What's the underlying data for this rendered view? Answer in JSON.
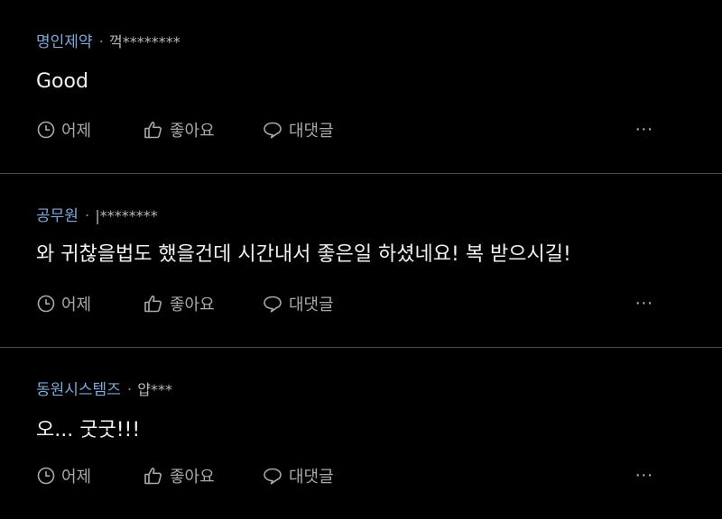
{
  "comments": [
    {
      "author": "명인제약",
      "separator": "·",
      "masked_user": "꺽********",
      "text": "Good",
      "time": "어제",
      "like_label": "좋아요",
      "reply_label": "대댓글",
      "more": "···"
    },
    {
      "author": "공무원",
      "separator": "·",
      "masked_user": "|********",
      "text": "와 귀찮을법도 했을건데 시간내서 좋은일 하셨네요! 복 받으시길!",
      "time": "어제",
      "like_label": "좋아요",
      "reply_label": "대댓글",
      "more": "···"
    },
    {
      "author": "동원시스템즈",
      "separator": "·",
      "masked_user": "얍***",
      "text": "오... 굿굿!!!",
      "time": "어제",
      "like_label": "좋아요",
      "reply_label": "대댓글",
      "more": "···"
    }
  ],
  "icons": {
    "time": "clock-icon",
    "like": "thumbs-up-icon",
    "reply": "speech-bubble-icon",
    "more": "more-icon"
  },
  "colors": {
    "background": "#000000",
    "author": "#7ea9d8",
    "muted": "#a9a9a9",
    "text": "#f2f2f2",
    "divider": "#4a4a4a"
  }
}
